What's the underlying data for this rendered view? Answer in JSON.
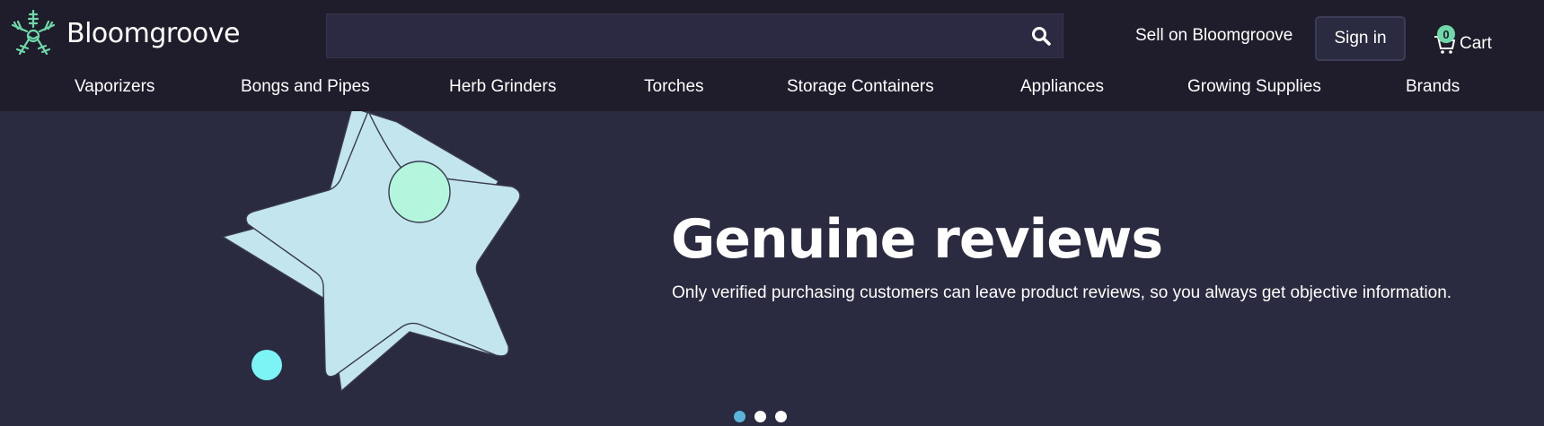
{
  "header": {
    "brand_name": "Bloomgroove",
    "search": {
      "placeholder": ""
    },
    "sell_link": "Sell on Bloomgroove",
    "sign_in": "Sign in",
    "cart": {
      "label": "Cart",
      "count": "0"
    }
  },
  "nav": {
    "items": [
      {
        "label": "Vaporizers"
      },
      {
        "label": "Bongs and Pipes"
      },
      {
        "label": "Herb Grinders"
      },
      {
        "label": "Torches"
      },
      {
        "label": "Storage Containers"
      },
      {
        "label": "Appliances"
      },
      {
        "label": "Growing Supplies"
      },
      {
        "label": "Brands"
      }
    ]
  },
  "hero": {
    "title": "Genuine reviews",
    "text": "Only verified purchasing customers can leave product reviews, so you always get objective information.",
    "slides_total": 3,
    "active_slide": 1
  },
  "icons": {
    "logo": "star-leaf-logo-icon",
    "search": "search-icon",
    "cart": "cart-icon"
  },
  "colors": {
    "header_bg": "#1f1d2b",
    "hero_bg": "#2a2a40",
    "star": "#c3e6ee",
    "mint_circle": "#b3f5dd",
    "cyan_circle": "#7cf3f5",
    "accent_green": "#6fd8a8",
    "active_dot": "#5ab5d8"
  }
}
